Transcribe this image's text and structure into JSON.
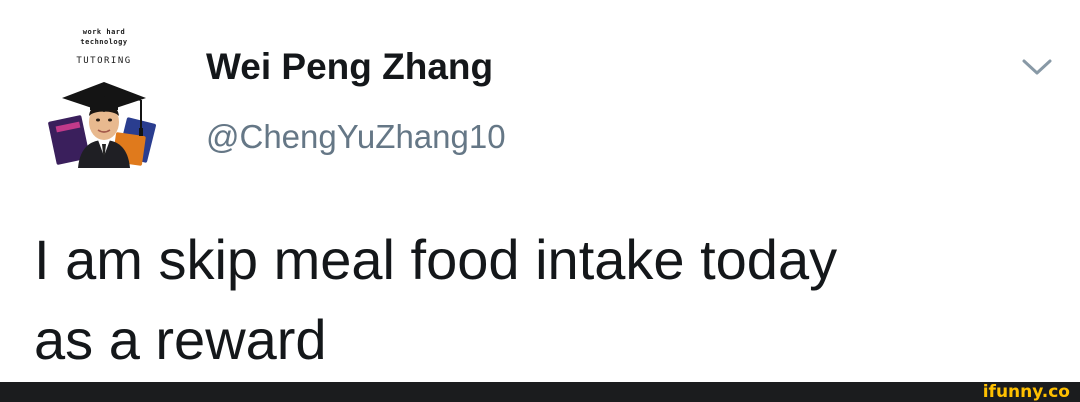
{
  "tweet": {
    "author": {
      "display_name": "Wei Peng Zhang",
      "handle": "@ChengYuZhang10",
      "avatar": {
        "brand_line_1": "work hard",
        "brand_line_2": "technology",
        "brand_line_3": "TUTORING"
      }
    },
    "text_line_1": "I am skip meal food intake today",
    "text_line_2": "as a reward",
    "menu_icon": "chevron-down-icon"
  },
  "footer": {
    "watermark": "ifunny.co",
    "watermark_color": "#ffc000",
    "bar_color": "#1b1c1e"
  },
  "colors": {
    "name": "#14171a",
    "handle": "#657786",
    "chevron": "#8899a6"
  }
}
